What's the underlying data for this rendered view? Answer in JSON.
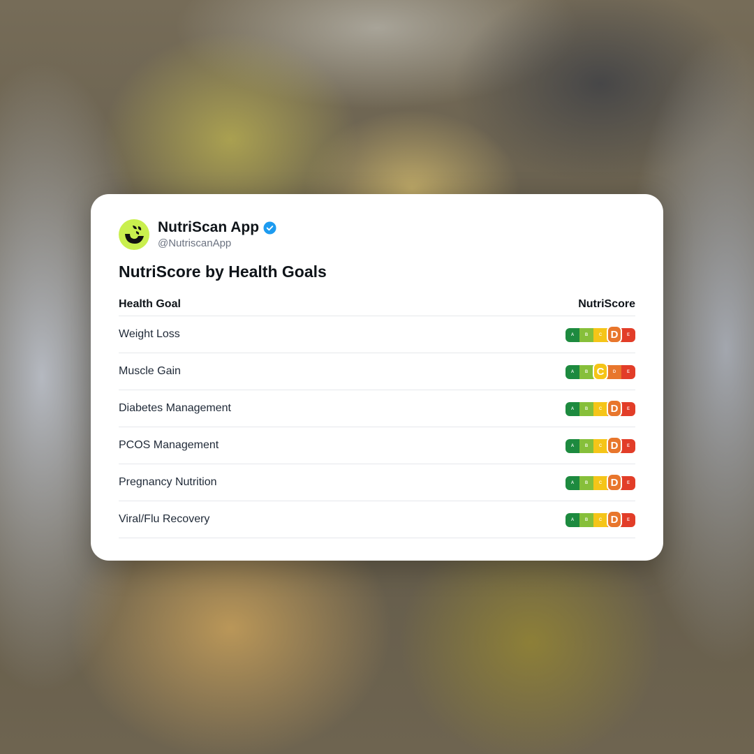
{
  "profile": {
    "name": "NutriScan App",
    "handle": "@NutriscanApp",
    "verified": true,
    "avatar_icon": "nutriscan-logo-icon",
    "avatar_color": "#c9ef4e",
    "verified_color": "#1d9bf0"
  },
  "title": "NutriScore by Health Goals",
  "table": {
    "columns": [
      "Health Goal",
      "NutriScore"
    ],
    "rows": [
      {
        "goal": "Weight Loss",
        "score": "D"
      },
      {
        "goal": "Muscle Gain",
        "score": "C"
      },
      {
        "goal": "Diabetes Management",
        "score": "D"
      },
      {
        "goal": "PCOS Management",
        "score": "D"
      },
      {
        "goal": "Pregnancy Nutrition",
        "score": "D"
      },
      {
        "goal": "Viral/Flu Recovery",
        "score": "D"
      }
    ]
  },
  "nutriscore": {
    "grades": [
      "A",
      "B",
      "C",
      "D",
      "E"
    ],
    "colors": {
      "A": "#1d8a3f",
      "B": "#86bf3a",
      "C": "#f5c518",
      "D": "#e8762c",
      "E": "#e23d28"
    }
  }
}
